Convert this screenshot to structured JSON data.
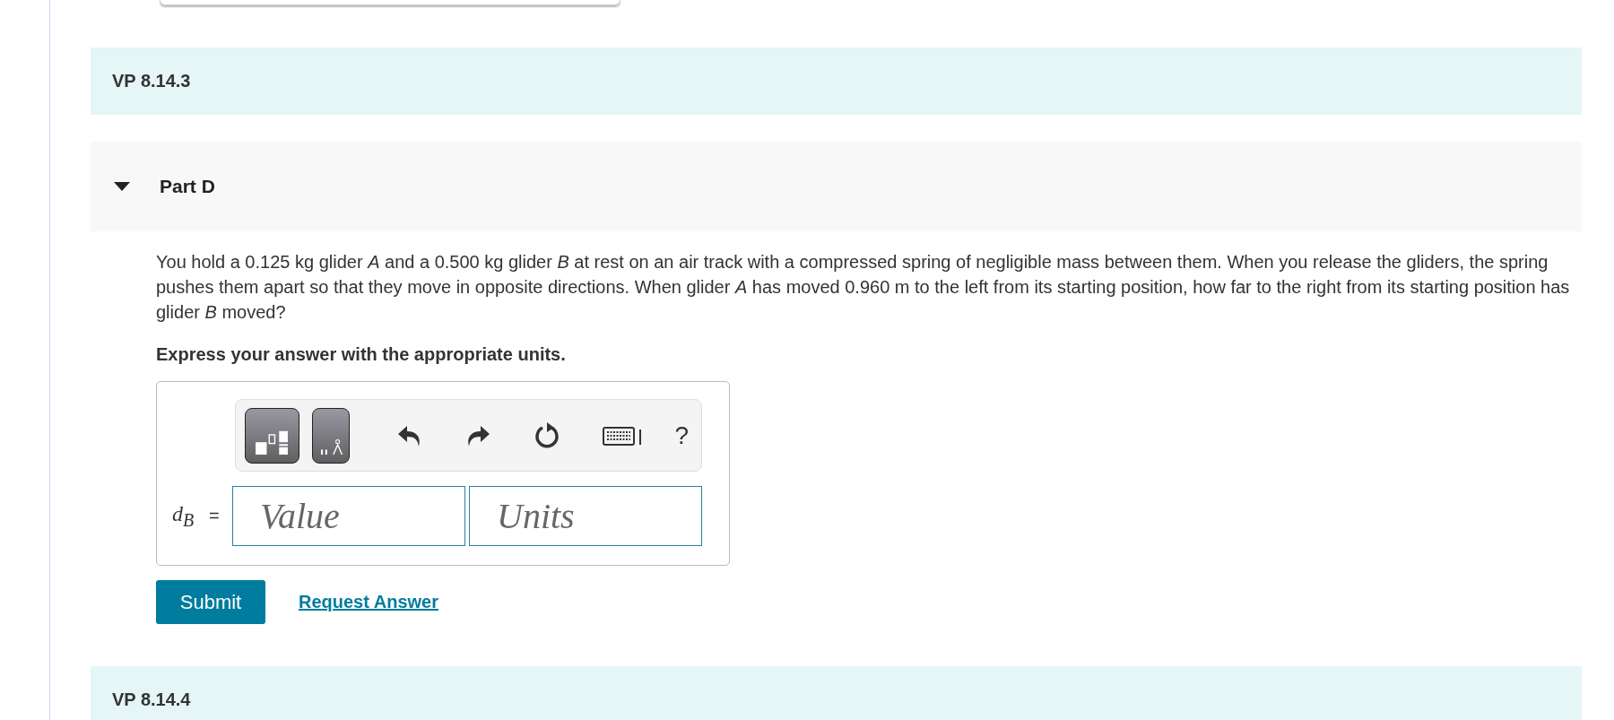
{
  "sections": [
    {
      "title": "VP 8.14.3"
    }
  ],
  "part": {
    "title": "Part D",
    "expanded": true,
    "question": "You hold a 0.125 kg glider *A* and a 0.500 kg glider *B* at rest on an air track with a compressed spring of negligible mass between them. When you release the gliders, the spring pushes them apart so that they move in opposite directions. When glider *A* has moved 0.960 m to the left from its starting position, how far to the right from its starting position has glider *B* moved?",
    "instruction": "Express your answer with the appropriate units.",
    "answer": {
      "variable": "d$_{B}$",
      "equals": "=",
      "value_placeholder": "Value",
      "units_placeholder": "Units",
      "help": "?"
    },
    "submit": "Submit",
    "request": "Request Answer"
  },
  "next_section": {
    "title": "VP 8.14.4"
  }
}
